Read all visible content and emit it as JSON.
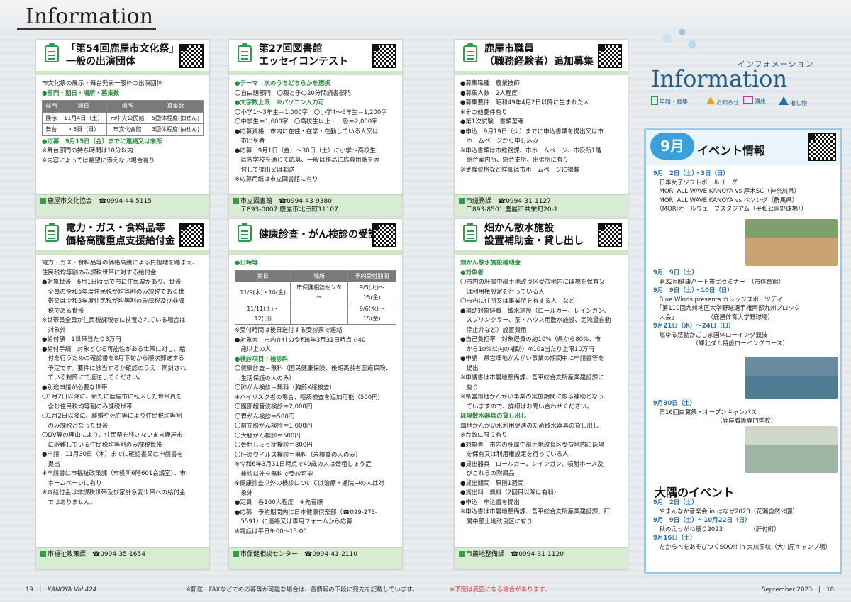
{
  "header": {
    "logo": "Information"
  },
  "cards": [
    {
      "id": "c1",
      "title": [
        "「第54回鹿屋市文化祭」",
        "一般の出演団体"
      ],
      "lines": [
        {
          "t": "市文化祭の展示・舞台発表一般枠の出演団体"
        },
        {
          "t": "●部門・期日・場所・募集数",
          "c": "sec"
        }
      ],
      "table": {
        "head": [
          "部門",
          "期日",
          "場所",
          "募集数"
        ],
        "rows": [
          [
            "展示",
            "11月4日（土）",
            "市中央公民館",
            "5団体程度(抽せん)"
          ],
          [
            "舞台",
            "・5日（日）",
            "市文化会館",
            "3団体程度(抽せん)"
          ]
        ]
      },
      "lines2": [
        {
          "t": "●応募　9月15日（金）までに連絡又は来所",
          "c": "g"
        },
        {
          "t": "※舞台部門の持ち時間は10分以内"
        },
        {
          "t": "※内容によっては希望に添えない場合有り"
        }
      ],
      "footer": "鹿屋市文化協会　☎0994-44-5115"
    },
    {
      "id": "c2",
      "title": [
        "第27回図書館",
        "エッセイコンテスト"
      ],
      "lines": [
        {
          "t": "●テーマ　次のうちどちらかを選択",
          "c": "g"
        },
        {
          "t": "〇自由題部門　〇親と子の20分間読書部門"
        },
        {
          "t": "●文字数上限　※パソコン入力可",
          "c": "g"
        },
        {
          "t": "〇小学1～3年生＝1,000字　〇小学4～6年生＝1,200字"
        },
        {
          "t": "〇中学生＝1,600字　〇高校生以上・一般＝2,000字"
        },
        {
          "t": "●応募資格　市内に在住・在学・在勤している人又は"
        },
        {
          "t": "　市出身者"
        },
        {
          "t": "●応募　9月1日（金）～30日（土）に小学～高校生"
        },
        {
          "t": "　は各学校を通じて応募、一般は作品に応募用紙を添"
        },
        {
          "t": "　付して提出又は郵送"
        },
        {
          "t": "※応募用紙は市立図書館に有り"
        }
      ],
      "footer": "市立図書館　☎0994-43-9380",
      "footer2": "〒893-0007 鹿屋市北田町11107"
    },
    {
      "id": "c3",
      "title": [
        "鹿屋市職員",
        "（職務経験者）追加募集"
      ],
      "lines": [
        {
          "t": "●募集職種　農業技師"
        },
        {
          "t": "●募集人数　2人程度"
        },
        {
          "t": "●募集要件　昭和49年4月2日以降に生まれた人"
        },
        {
          "t": "※その他要件有り"
        },
        {
          "t": "●第1次試験　書類選考"
        },
        {
          "t": "●申込　9月19日（火）までに申込書類を提出又は市"
        },
        {
          "t": "　ホームページから申し込み"
        },
        {
          "t": "※申込書類は市総務課、市ホームページ、市役所1階"
        },
        {
          "t": "　総合案内所、総合支所、出張所に有り"
        },
        {
          "t": "※受験資格など詳細は市ホームページに掲載"
        }
      ],
      "footer": "市総務課　☎0994-31-1127",
      "footer2": "〒893-8501 鹿屋市共栄町20-1"
    },
    {
      "id": "c4",
      "title": [
        "電力・ガス・食料品等",
        "価格高騰重点支援給付金"
      ],
      "lines": [
        {
          "t": "電力・ガス・食料品等の価格高騰による負担増を踏まえ、"
        },
        {
          "t": "住民税均等割のみ課税世帯に対する給付金"
        },
        {
          "t": "●対象世帯　6月1日時点で市に住民票があり、世帯"
        },
        {
          "t": "　全員の令和5年度住民税が均等割のみ課税である世"
        },
        {
          "t": "　帯又は令和5年度住民税が均等割のみ課税及び非課"
        },
        {
          "t": "　税である世帯"
        },
        {
          "t": "※世帯員全員が住民税課税者に扶養されている場合は"
        },
        {
          "t": "　対象外"
        },
        {
          "t": "●給付額　1世帯当たり3万円"
        },
        {
          "t": "●給付手続　対象となる可能性がある世帯に対し、給"
        },
        {
          "t": "　付を行うための確認書を8月下旬から順次郵送する"
        },
        {
          "t": "　予定です。要件に該当するか確認のうえ、同封され"
        },
        {
          "t": "　ている封筒にて返送してください。"
        },
        {
          "t": "●別途申請が必要な世帯"
        },
        {
          "t": "〇1月2日以降に、新たに鹿屋市に転入した世帯員を"
        },
        {
          "t": "　含む住民税均等割のみ課税世帯"
        },
        {
          "t": "〇1月2日以降に、離婚や死亡等により住民税均等割"
        },
        {
          "t": "　のみ課税となった世帯"
        },
        {
          "t": "〇DV等の理由により、住民票を移さないまま鹿屋市"
        },
        {
          "t": "　に避難している住民税均等割のみ課税世帯"
        },
        {
          "t": "●申請　11月30日（木）までに確認書又は申請書を"
        },
        {
          "t": "　提出"
        },
        {
          "t": "※申請書は市福祉政策課（市役所6階601会議室）、市"
        },
        {
          "t": "　ホームページに有り"
        },
        {
          "t": "※本給付金は非課税世帯及び家計急変世帯への給付金"
        },
        {
          "t": "　ではありません。"
        }
      ],
      "footer": "市福祉政策課　☎0994-35-1654"
    },
    {
      "id": "c5",
      "title": [
        "健康診査・がん検診の受診者"
      ],
      "lines": [
        {
          "t": "●日時等",
          "c": "g"
        }
      ],
      "table": {
        "head": [
          "期日",
          "場所",
          "予約受付期間"
        ],
        "rows": [
          [
            "11/9(木)・10(金)",
            "市保健相談センター",
            "9/5(火)～15(金)"
          ],
          [
            "11/11(土)・12(日)",
            "",
            "9/6(水)～15(金)"
          ]
        ]
      },
      "lines2": [
        {
          "t": "※受付時間は後日送付する受診票で連絡"
        },
        {
          "t": "●対象者　市内在住の令和6年3月31日時点で40"
        },
        {
          "t": "　歳以上の人"
        },
        {
          "t": "●検診項目・検診料",
          "c": "g"
        },
        {
          "t": "〇健康診査＝無料（国民健康保険、後期高齢者医療保険、"
        },
        {
          "t": "　生活保護の人のみ）"
        },
        {
          "t": "〇肺がん検診＝無料（胸部X線検査）"
        },
        {
          "t": "※ハイリスク者の場合、喀痰検査を追加可能（500円）"
        },
        {
          "t": "〇腹部超音波検診＝2,000円"
        },
        {
          "t": "〇胃がん検診＝500円"
        },
        {
          "t": "〇前立腺がん検診＝1,000円"
        },
        {
          "t": "〇大腸がん検診＝500円"
        },
        {
          "t": "〇骨粗しょう症検診＝800円"
        },
        {
          "t": "〇肝炎ウイルス検診＝無料（未検査の人のみ）"
        },
        {
          "t": "※令和6年3月31日時点で40歳の人は骨粗しょう症"
        },
        {
          "t": "　検診以外を無料で受診可能"
        },
        {
          "t": "※健康診査以外の検診については治療・通院中の人は対"
        },
        {
          "t": "　象外"
        },
        {
          "t": "●定員　各160人程度　※先着順"
        },
        {
          "t": "●応募　予約期間内に日本健康倶楽部（☎099-273-"
        },
        {
          "t": "　5591）に連絡又は専用フォームから応募"
        },
        {
          "t": "※電話は平日9:00～15:00"
        }
      ],
      "footer": "市保健相談センター　☎0994-41-2110"
    },
    {
      "id": "c6",
      "title": [
        "畑かん散水施設",
        "設置補助金・貸し出し"
      ],
      "lines": [
        {
          "t": "畑かん散水施設補助金",
          "c": "g"
        },
        {
          "t": "●対象者",
          "c": "g"
        },
        {
          "t": "〇市内の肝属中部土地改良区受益地内にほ場を保有又"
        },
        {
          "t": "　は利用権設定を行っている人"
        },
        {
          "t": "〇市内に住所又は事業所を有する人　など"
        },
        {
          "t": "●補助対象経費　散水施設（ロールカー、レインガン、"
        },
        {
          "t": "　スプリンクラー、茶・ハウス用散水施設、定流量自動"
        },
        {
          "t": "　停止弁など）設置費用"
        },
        {
          "t": "●自己負担率　対象経費の約10%（県から80%、市"
        },
        {
          "t": "　から10%以内の補助）※10a当たり上限10万円"
        },
        {
          "t": "●申請　県営畑地かんがい事業の期間中に申請書等を"
        },
        {
          "t": "　提出"
        },
        {
          "t": "※申請書は市農地整備課、吾平総合支所産業建設課に"
        },
        {
          "t": "　有り"
        },
        {
          "t": "※県営畑地かんがい事業の実施期間に限る補助となっ"
        },
        {
          "t": "　ていますので、詳細はお問い合わせください。"
        },
        {
          "t": "ほ場散水器具の貸し出し",
          "c": "g"
        },
        {
          "t": "畑地かんがい水利用促進のため散水器具の貸し出し"
        },
        {
          "t": "※台数に限り有り"
        },
        {
          "t": "●対象者　市内の肝属中部土地改良区受益地内にほ場"
        },
        {
          "t": "　を保有又は利用権設定を行っている人"
        },
        {
          "t": "●貸出器具　ロールカー、レインガン、噴射ホース及"
        },
        {
          "t": "　びこれらの附属品"
        },
        {
          "t": "●貸出期間　原則1週間"
        },
        {
          "t": "●貸出料　無料（2回目以降は有料）"
        },
        {
          "t": "●申込　申込書を提出"
        },
        {
          "t": "※申込書は市農地整備課、吾平総合支所産業建設課、肝"
        },
        {
          "t": "　属中部土地改良区に有り"
        }
      ],
      "footer": "市農地整備課　☎0994-31-1120"
    }
  ],
  "right": {
    "kana": "インフォメーション",
    "logo": "Information",
    "cats": [
      "申請・募集",
      "お知らせ",
      "講座",
      "催し物"
    ],
    "badge": "9月",
    "ev_title": "イベント情報",
    "events": [
      {
        "t": "9月　2日（土）・3日（日）",
        "c": "d"
      },
      {
        "t": "　日本女子ソフトボールリーグ"
      },
      {
        "t": "　MORI ALL WAVE KANOYA vs 厚木SC（神奈川県）"
      },
      {
        "t": "　MORI ALL WAVE KANOYA vs ペヤング（群馬県）"
      },
      {
        "t": "　（MORIオールウェーブスタジアム（平和公園野球場））"
      }
    ],
    "events2": [
      {
        "t": "9月　9日（土）",
        "c": "d"
      },
      {
        "t": "　第32回健康ハート市民セミナー　（市体育館）"
      },
      {
        "t": "9月　9日（土）・10日（日）",
        "c": "d"
      },
      {
        "t": "　Blue Winds presents カレッジスポーツデイ"
      },
      {
        "t": "　「第110回九州地区大学野球選手権南部九州ブロック"
      },
      {
        "t": "　大会」　　　　　　（鹿屋体育大学野球場）"
      },
      {
        "t": "9月21日（木）～24日（日）",
        "c": "d"
      },
      {
        "t": "　燃ゆる感動かごしま国体ローイング競技"
      },
      {
        "t": "　　　　　　　（輝北ダム特設ローイングコース）"
      }
    ],
    "events3": [
      {
        "t": "9月30日（土）",
        "c": "d"
      },
      {
        "t": "　第16回白鷺祭・オープンキャンパス"
      },
      {
        "t": "　　　　　　　　　　　（鹿屋看護専門学校）"
      }
    ],
    "osumi_title": "大隅のイベント",
    "osumi": [
      {
        "t": "9月　2日（土）",
        "c": "d"
      },
      {
        "t": "　やまんなか音楽会 in はなぜ2023（花瀬自然公園）"
      },
      {
        "t": "9月　9日（土）～10月22日（日）",
        "c": "d"
      },
      {
        "t": "　秋のえっがね祭り2023　　　　　（肝付町）"
      },
      {
        "t": "9月16日（土）",
        "c": "d"
      },
      {
        "t": "　たからべをあそびつくSOO!! in 大川原峡（大川原キャンプ場）"
      }
    ]
  },
  "footer": {
    "left_page": "19",
    "left_mag": "KANOYA Vol.424",
    "note": "※郵送・FAXなどでの応募等が可能な場合は、各情報の下段に宛先を記載しています。",
    "red": "※予定は変更になる場合があります。",
    "right": "September 2023",
    "right_page": "18"
  }
}
